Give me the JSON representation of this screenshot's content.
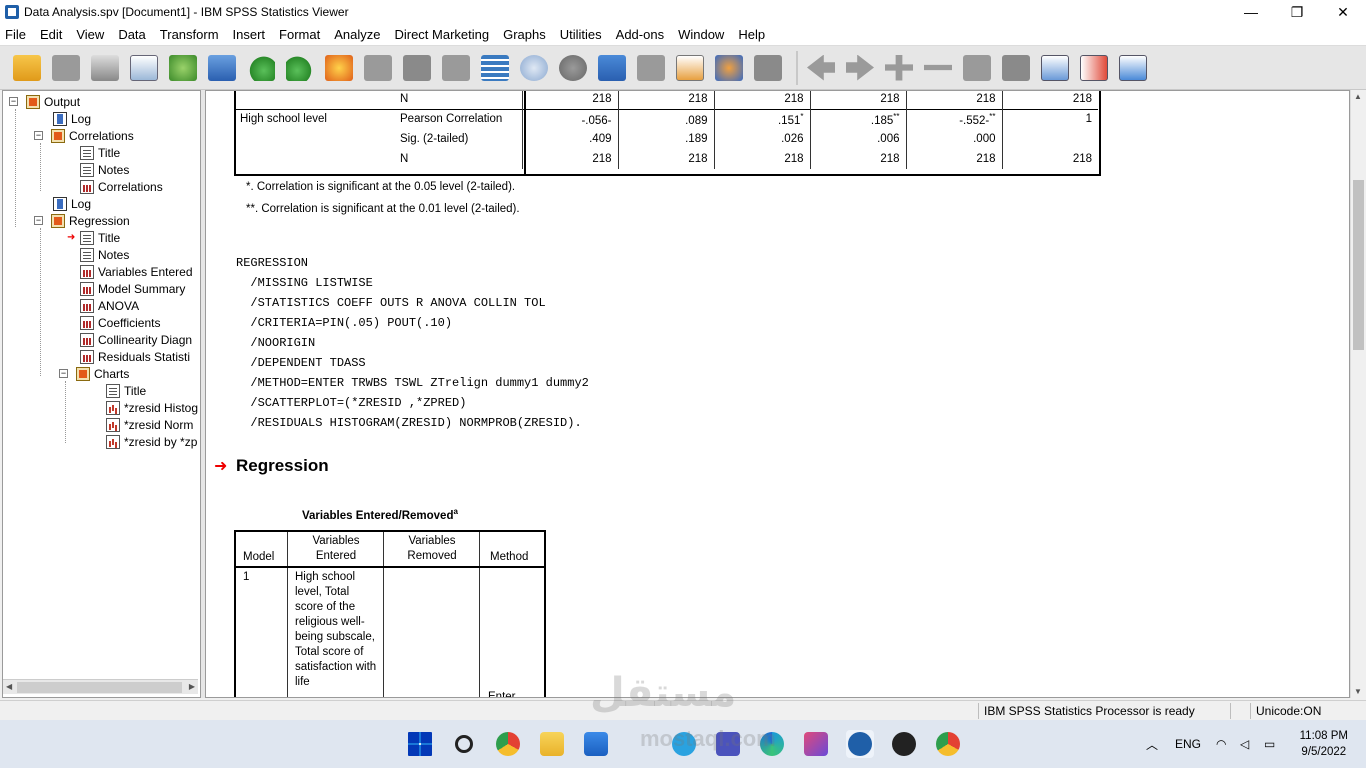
{
  "window": {
    "title": "Data Analysis.spv [Document1] - IBM SPSS Statistics Viewer",
    "minimize": "—",
    "maximize": "❐",
    "close": "✕"
  },
  "menu": [
    "File",
    "Edit",
    "View",
    "Data",
    "Transform",
    "Insert",
    "Format",
    "Analyze",
    "Direct Marketing",
    "Graphs",
    "Utilities",
    "Add-ons",
    "Window",
    "Help"
  ],
  "toolbar_icons": [
    "open-icon",
    "save-icon",
    "print-icon",
    "print-preview-icon",
    "export-icon",
    "recall-dialog-icon",
    "undo-icon",
    "redo-icon",
    "goto-data-icon",
    "goto-case-icon",
    "goto-variable-icon",
    "variables-icon",
    "use-variable-sets-icon",
    "show-all-variables-icon",
    "split-file-icon",
    "select-cases-icon",
    "weight-cases-icon",
    "designate-window-icon",
    "run-script-icon",
    "insert-output-icon",
    "previous-icon",
    "next-icon",
    "expand-icon",
    "collapse-icon",
    "show-icon",
    "hide-icon",
    "insert-heading-icon",
    "insert-title-icon",
    "insert-text-icon"
  ],
  "tree": {
    "items": [
      {
        "label": "Output",
        "level": 0,
        "icon": "book"
      },
      {
        "label": "Log",
        "level": 1,
        "icon": "log"
      },
      {
        "label": "Correlations",
        "level": 1,
        "icon": "book"
      },
      {
        "label": "Title",
        "level": 2,
        "icon": "doc"
      },
      {
        "label": "Notes",
        "level": 2,
        "icon": "doc"
      },
      {
        "label": "Correlations",
        "level": 2,
        "icon": "tbl"
      },
      {
        "label": "Log",
        "level": 1,
        "icon": "log"
      },
      {
        "label": "Regression",
        "level": 1,
        "icon": "book"
      },
      {
        "label": "Title",
        "level": 2,
        "icon": "doc"
      },
      {
        "label": "Notes",
        "level": 2,
        "icon": "doc"
      },
      {
        "label": "Variables Entered",
        "level": 2,
        "icon": "tbl"
      },
      {
        "label": "Model Summary",
        "level": 2,
        "icon": "tbl"
      },
      {
        "label": "ANOVA",
        "level": 2,
        "icon": "tbl"
      },
      {
        "label": "Coefficients",
        "level": 2,
        "icon": "tbl"
      },
      {
        "label": "Collinearity Diagn",
        "level": 2,
        "icon": "tbl"
      },
      {
        "label": "Residuals Statisti",
        "level": 2,
        "icon": "tbl"
      },
      {
        "label": "Charts",
        "level": 2,
        "icon": "book"
      },
      {
        "label": "Title",
        "level": 3,
        "icon": "doc"
      },
      {
        "label": "*zresid Histog",
        "level": 3,
        "icon": "chart"
      },
      {
        "label": "*zresid Norm",
        "level": 3,
        "icon": "chart"
      },
      {
        "label": "*zresid by *zp",
        "level": 3,
        "icon": "chart"
      }
    ]
  },
  "correlations": {
    "rows": [
      {
        "c0": "",
        "c1": "N",
        "vals": [
          "218",
          "218",
          "218",
          "218",
          "218",
          "218"
        ]
      },
      {
        "c0": "High school level",
        "c1": "Pearson Correlation",
        "vals": [
          "-.056-",
          ".089",
          ".151",
          ".185",
          "-.552-",
          "1"
        ],
        "sups": [
          "",
          "",
          "*",
          "**",
          "**",
          ""
        ]
      },
      {
        "c0": "",
        "c1": "Sig. (2-tailed)",
        "vals": [
          ".409",
          ".189",
          ".026",
          ".006",
          ".000",
          ""
        ]
      },
      {
        "c0": "",
        "c1": "N",
        "vals": [
          "218",
          "218",
          "218",
          "218",
          "218",
          "218"
        ]
      }
    ],
    "footnote1": "*. Correlation is significant at the 0.05 level (2-tailed).",
    "footnote2": "**. Correlation is significant at the 0.01 level (2-tailed)."
  },
  "syntax": [
    "REGRESSION",
    "  /MISSING LISTWISE",
    "  /STATISTICS COEFF OUTS R ANOVA COLLIN TOL",
    "  /CRITERIA=PIN(.05) POUT(.10)",
    "  /NOORIGIN",
    "  /DEPENDENT TDASS",
    "  /METHOD=ENTER TRWBS TSWL ZTrelign dummy1 dummy2",
    "  /SCATTERPLOT=(*ZRESID ,*ZPRED)",
    "  /RESIDUALS HISTOGRAM(ZRESID) NORMPROB(ZRESID)."
  ],
  "heading": "Regression",
  "variables_entered": {
    "title": "Variables Entered/Removed",
    "title_sup": "a",
    "headers": [
      "Model",
      "Variables Entered",
      "Variables Removed",
      "Method"
    ],
    "row": {
      "model": "1",
      "entered": "High school level, Total score of the religious well-being subscale, Total score of satisfaction with life",
      "removed": "",
      "method": "Enter"
    }
  },
  "status": {
    "processor": "IBM SPSS Statistics Processor is ready",
    "unicode": "Unicode:ON"
  },
  "taskbar": {
    "icons": [
      "windows-start-icon",
      "search-icon",
      "chrome-icon",
      "file-explorer-icon",
      "mail-icon",
      "telegram-icon",
      "teams-icon",
      "edge-icon",
      "snipping-tool-icon",
      "spss-icon",
      "media-player-icon",
      "chrome-badge-icon"
    ],
    "tray_language": "ENG",
    "time": "11:08 PM",
    "date": "9/5/2022"
  },
  "watermark": {
    "line1": "مستقل",
    "line2": "mostaql.com"
  }
}
